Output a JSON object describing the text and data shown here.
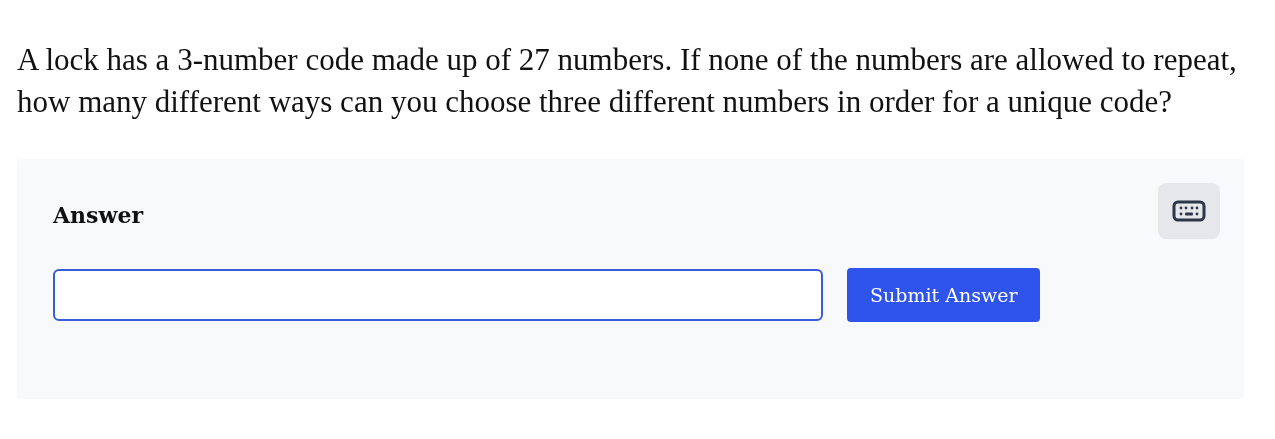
{
  "question": "A lock has a 3-number code made up of 27 numbers. If none of the numbers are allowed to repeat, how many different ways can you choose three different numbers in order for a unique code?",
  "answer_panel": {
    "title": "Answer",
    "field": {
      "focused": true
    },
    "submit_button": "Submit Answer"
  }
}
